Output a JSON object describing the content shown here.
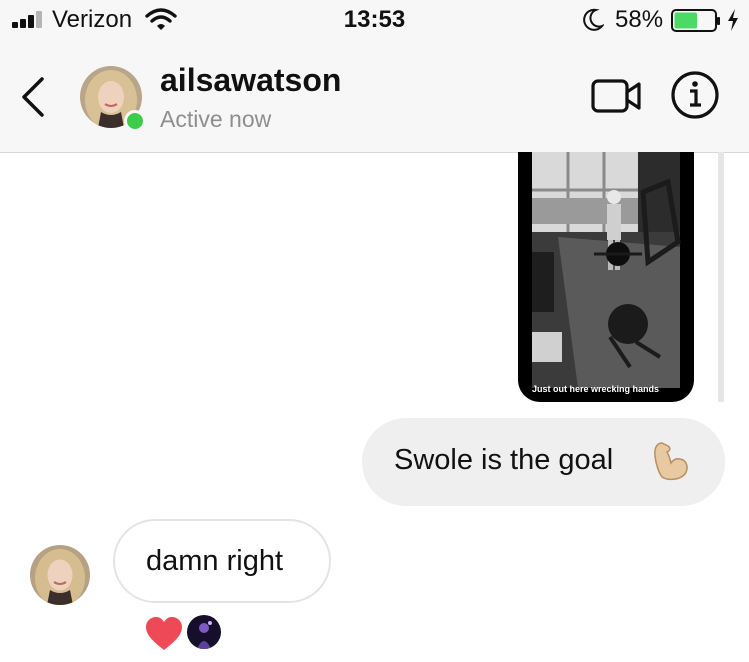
{
  "status_bar": {
    "carrier": "Verizon",
    "time": "13:53",
    "battery_percent": "58%",
    "battery_level": 0.58,
    "battery_color": "#4cd964"
  },
  "header": {
    "username": "ailsawatson",
    "status": "Active now",
    "online_color": "#3fcc4b",
    "icons": [
      "back-icon",
      "video-camera-icon",
      "info-icon"
    ]
  },
  "conversation": {
    "shared_media": {
      "caption": "Just out here wrecking hands"
    },
    "sent_message": {
      "text": "Swole is the goal",
      "emoji": "flexed-biceps-icon"
    },
    "received_message": {
      "text": "damn right"
    },
    "reactions": {
      "icons": [
        "heart-icon",
        "reactor-avatar"
      ],
      "heart_color": "#ed4956"
    }
  }
}
